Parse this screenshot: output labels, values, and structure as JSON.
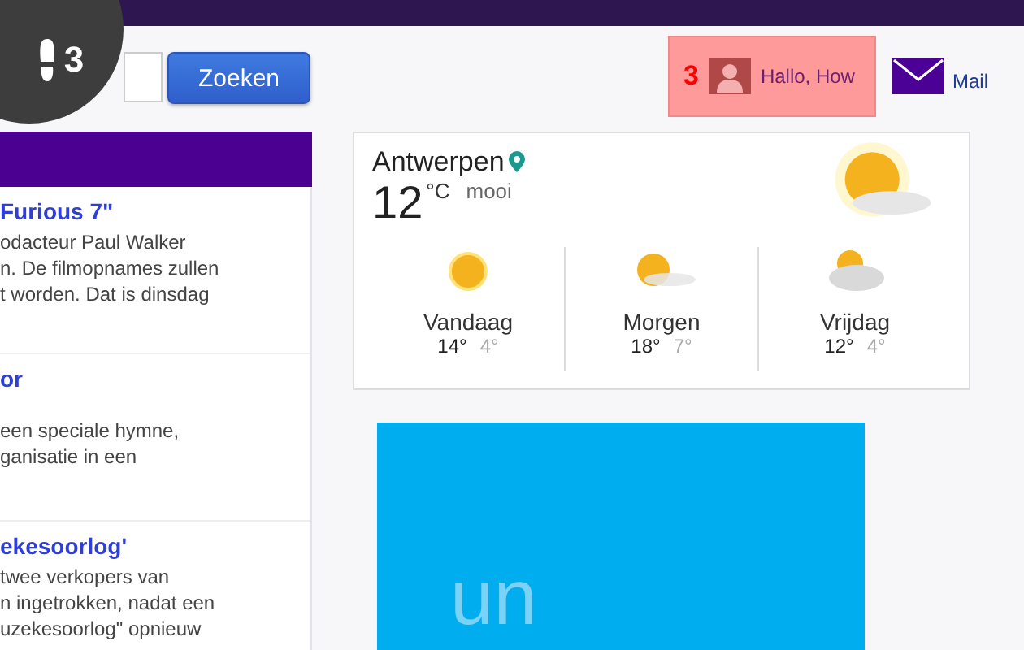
{
  "badge": {
    "count": "3"
  },
  "search": {
    "button": "Zoeken"
  },
  "user": {
    "count": "3",
    "greeting": "Hallo, How",
    "highlighted": true
  },
  "mail": {
    "label": "Mail"
  },
  "news": [
    {
      "title": "Furious 7\"",
      "lines": [
        "odacteur Paul Walker",
        "n. De filmopnames zullen",
        "t worden. Dat is dinsdag"
      ]
    },
    {
      "title": "or",
      "lines": [
        "een speciale hymne,",
        "ganisatie in een"
      ]
    },
    {
      "title": "ekesoorlog'",
      "lines": [
        "twee verkopers van",
        "n ingetrokken, nadat een",
        "uzekesoorlog\" opnieuw"
      ]
    }
  ],
  "weather": {
    "city": "Antwerpen",
    "temp": "12",
    "unit": "°C",
    "condition": "mooi",
    "kind": "sun-cloud",
    "days": [
      {
        "name": "Vandaag",
        "high": "14°",
        "low": "4°",
        "kind": "sun"
      },
      {
        "name": "Morgen",
        "high": "18°",
        "low": "7°",
        "kind": "sun-cloud"
      },
      {
        "name": "Vrijdag",
        "high": "12°",
        "low": "4°",
        "kind": "cloud"
      }
    ]
  },
  "ad": {
    "text": "un"
  }
}
